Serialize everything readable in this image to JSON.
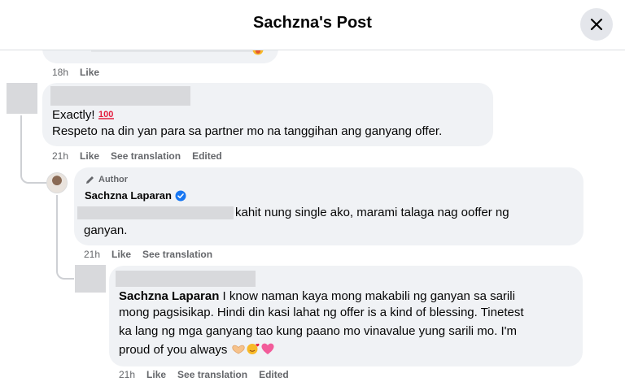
{
  "header": {
    "title": "Sachzna's Post"
  },
  "comment_prev": {
    "time": "18h",
    "like": "Like"
  },
  "comment1": {
    "line1": "Exactly! ",
    "line2": "Respeto na din yan para sa partner mo na tanggihan ang ganyang offer.",
    "time": "21h",
    "like": "Like",
    "translate": "See translation",
    "edited": "Edited"
  },
  "reply1": {
    "author_badge": "Author",
    "name": "Sachzna Laparan",
    "line1": "kahit nung single ako, marami talaga nag ooffer ng",
    "line2": "ganyan.",
    "time": "21h",
    "like": "Like",
    "translate": "See translation"
  },
  "reply2": {
    "mention": "Sachzna Laparan",
    "line1": " I know naman kaya mong makabili ng ganyan sa sarili",
    "line2": "mong pagsisikap. Hindi din kasi lahat ng offer is a kind of blessing. Tinetest",
    "line3": "ka lang ng mga ganyang tao kung paano mo vinavalue yung sarili mo. I'm",
    "line4": "proud of you always ",
    "time": "21h",
    "like": "Like",
    "translate": "See translation",
    "edited": "Edited"
  },
  "colors": {
    "accent": "#1877f2",
    "bubble": "#f0f2f5",
    "meta": "#65676b",
    "hundred": "#e41e3f",
    "heart": "#f25c9a"
  }
}
